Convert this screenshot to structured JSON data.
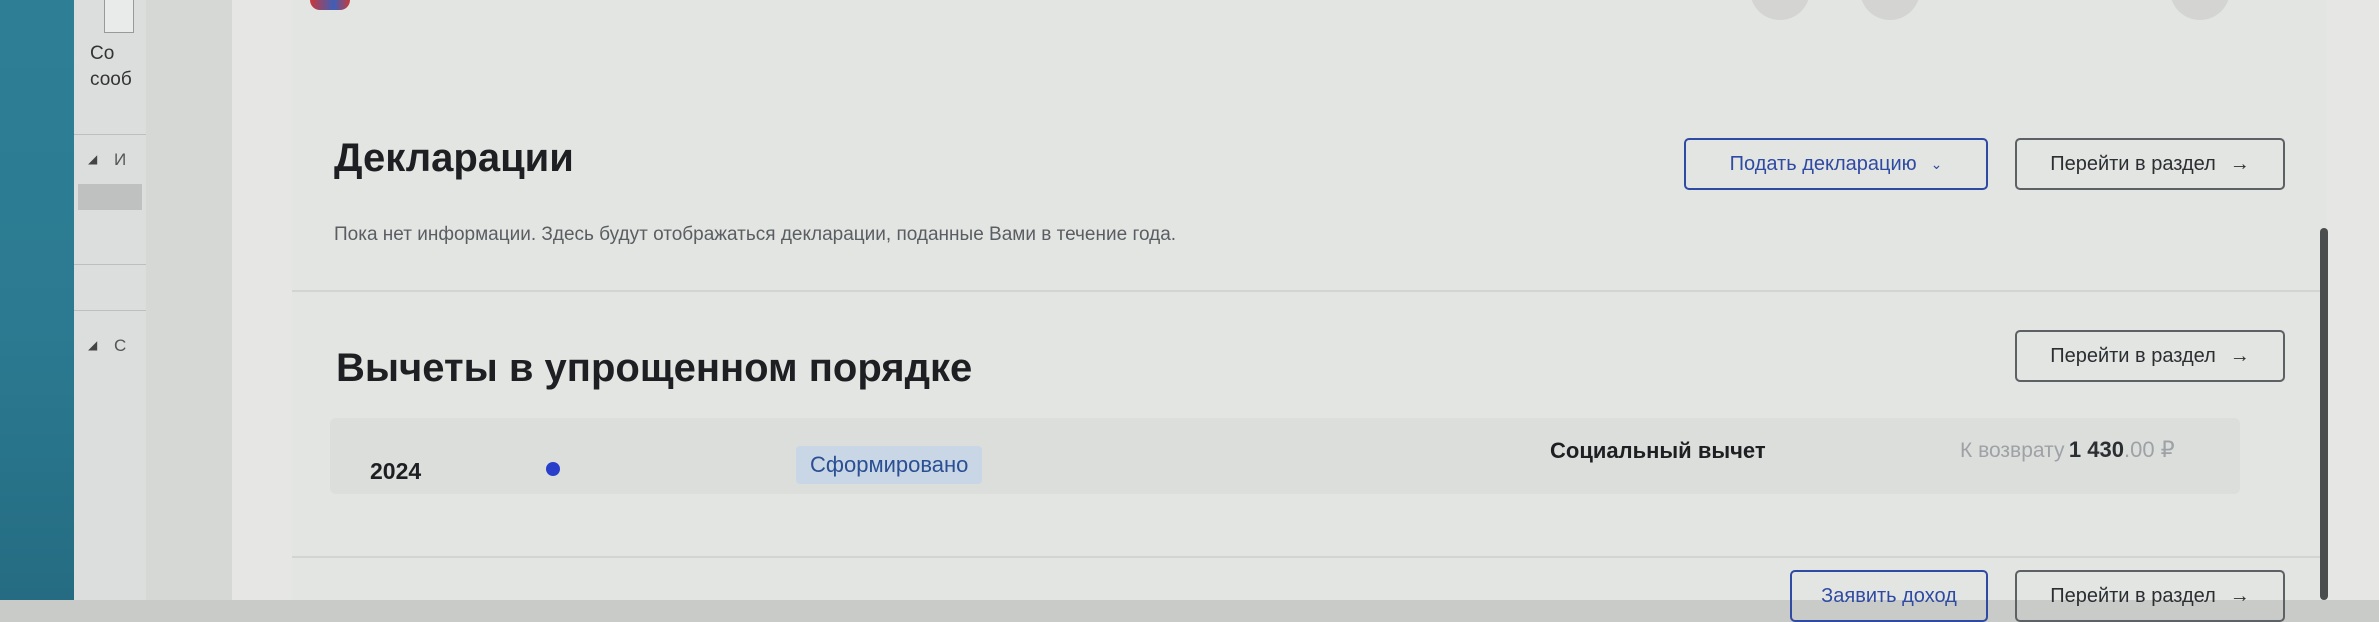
{
  "left_panel": {
    "text_line1": "Со",
    "text_line2": "сооб",
    "tree1_letter": "И",
    "tree2_letter": "С"
  },
  "declarations": {
    "title": "Декларации",
    "info": "Пока нет информации. Здесь будут отображаться декларации, поданные Вами в течение года.",
    "submit_label": "Подать декларацию",
    "goto_label": "Перейти в раздел"
  },
  "deductions": {
    "title": "Вычеты в упрощенном порядке",
    "goto_label": "Перейти в раздел",
    "row": {
      "year": "2024",
      "status": "Сформировано",
      "type": "Социальный вычет",
      "refund_label": "К возврату",
      "refund_amount": "1 430",
      "refund_decimals": ".00 ₽"
    }
  },
  "income": {
    "declare_label": "Заявить доход",
    "goto_label": "Перейти в раздел"
  },
  "icons": {
    "arrow": "→",
    "chevron": "⌄"
  },
  "colors": {
    "accent": "#2f4aa3",
    "status_bg": "#c9d6e5",
    "status_text": "#2a4f92",
    "dot": "#2a3fc9"
  }
}
